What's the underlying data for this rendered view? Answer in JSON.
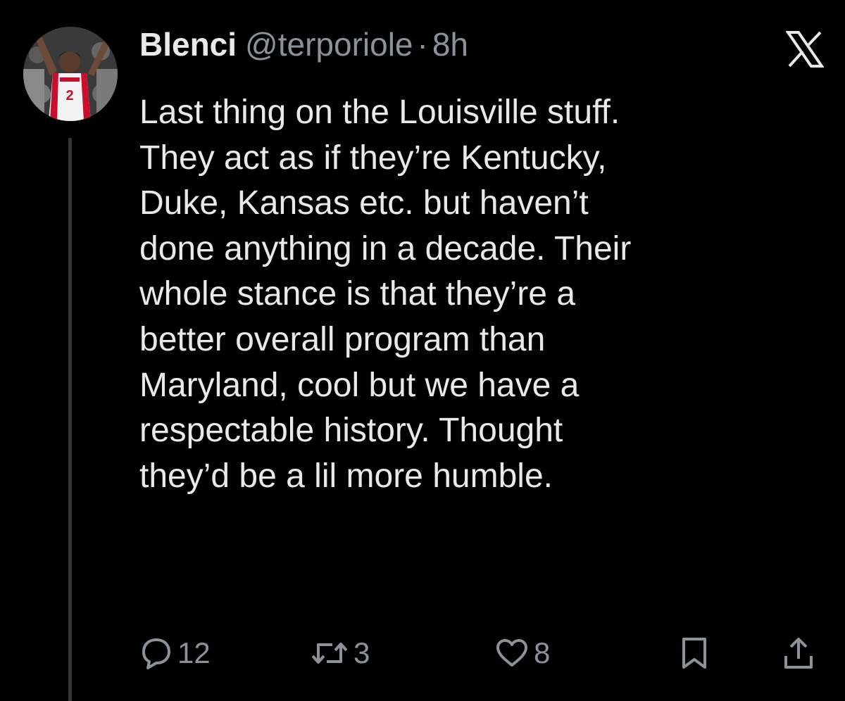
{
  "tweet": {
    "author_name": "Blenci",
    "author_handle": "@terporiole",
    "separator": "·",
    "timestamp": "8h",
    "text": "Last thing on the Louisville stuff.\nThey act as if they’re Kentucky,\nDuke, Kansas etc. but haven’t\ndone anything in a decade. Their\nwhole stance is that they’re a\nbetter overall program than\nMaryland, cool but we have a\nrespectable history. Thought\nthey’d be a lil more humble.",
    "avatar_badge_number": "2"
  },
  "actions": {
    "replies": "12",
    "reposts": "3",
    "likes": "8",
    "icons": [
      "reply-icon",
      "repost-icon",
      "like-icon",
      "bookmark-icon",
      "share-icon"
    ]
  },
  "colors": {
    "background": "#000000",
    "text": "#e7e9ea",
    "muted": "#8b9299",
    "thread_line": "#333639"
  }
}
